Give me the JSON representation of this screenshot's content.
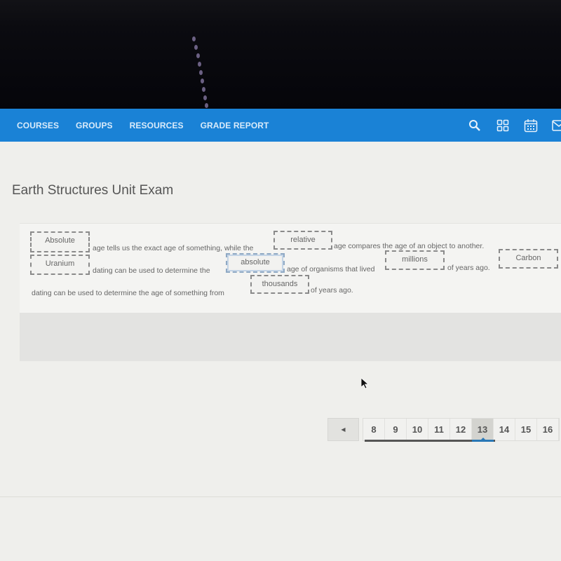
{
  "nav": {
    "items": [
      "COURSES",
      "GROUPS",
      "RESOURCES",
      "GRADE REPORT"
    ],
    "icons": [
      "search-icon",
      "apps-grid-icon",
      "calendar-icon",
      "mail-icon"
    ],
    "accent_color": "#1a82d6"
  },
  "page": {
    "title": "Earth Structures Unit Exam"
  },
  "question": {
    "text_segments": [
      "age tells us the exact age of something, while the",
      "age compares the age of an object to another.",
      "dating can be used to determine the",
      "age of organisms that lived",
      "of years ago.",
      "dating can be used to determine the age of something from",
      "of years ago."
    ],
    "answer_boxes": [
      {
        "value": "Absolute",
        "selected": false
      },
      {
        "value": "relative",
        "selected": false
      },
      {
        "value": "Uranium",
        "selected": false
      },
      {
        "value": "absolute",
        "selected": true
      },
      {
        "value": "millions",
        "selected": false
      },
      {
        "value": "Carbon",
        "selected": false
      },
      {
        "value": "thousands",
        "selected": false
      }
    ]
  },
  "pagination": {
    "prev_icon": "caret-left-icon",
    "prev_glyph": "◀",
    "pages": [
      "8",
      "9",
      "10",
      "11",
      "12",
      "13",
      "14",
      "15",
      "16"
    ],
    "current_page": "13"
  }
}
